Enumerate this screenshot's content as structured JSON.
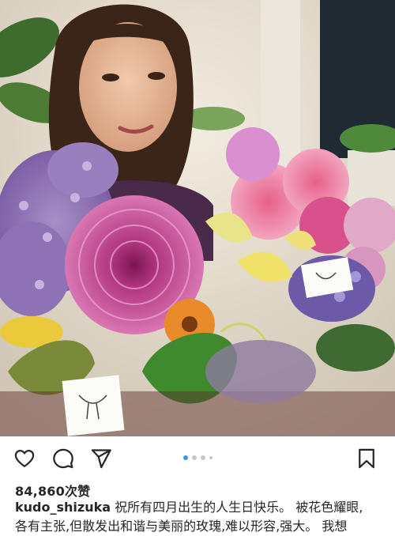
{
  "post": {
    "image_alt": "Woman holding a large bouquet of colorful flowers",
    "carousel": {
      "count": 4,
      "active_index": 0
    }
  },
  "actions": {
    "like_icon": "heart-outline-icon",
    "comment_icon": "comment-bubble-icon",
    "share_icon": "paper-plane-icon",
    "save_icon": "bookmark-outline-icon"
  },
  "likes": {
    "text": "84,860次赞"
  },
  "caption": {
    "username": "kudo_shizuka",
    "line1": " 祝所有四月出生的人生日快乐。 被花色耀眼,",
    "line2": "各有主张,但散发出和谐与美丽的玫瑰,难以形容,强大。 我想"
  },
  "colors": {
    "accent": "#3897f0",
    "text": "#262626"
  }
}
